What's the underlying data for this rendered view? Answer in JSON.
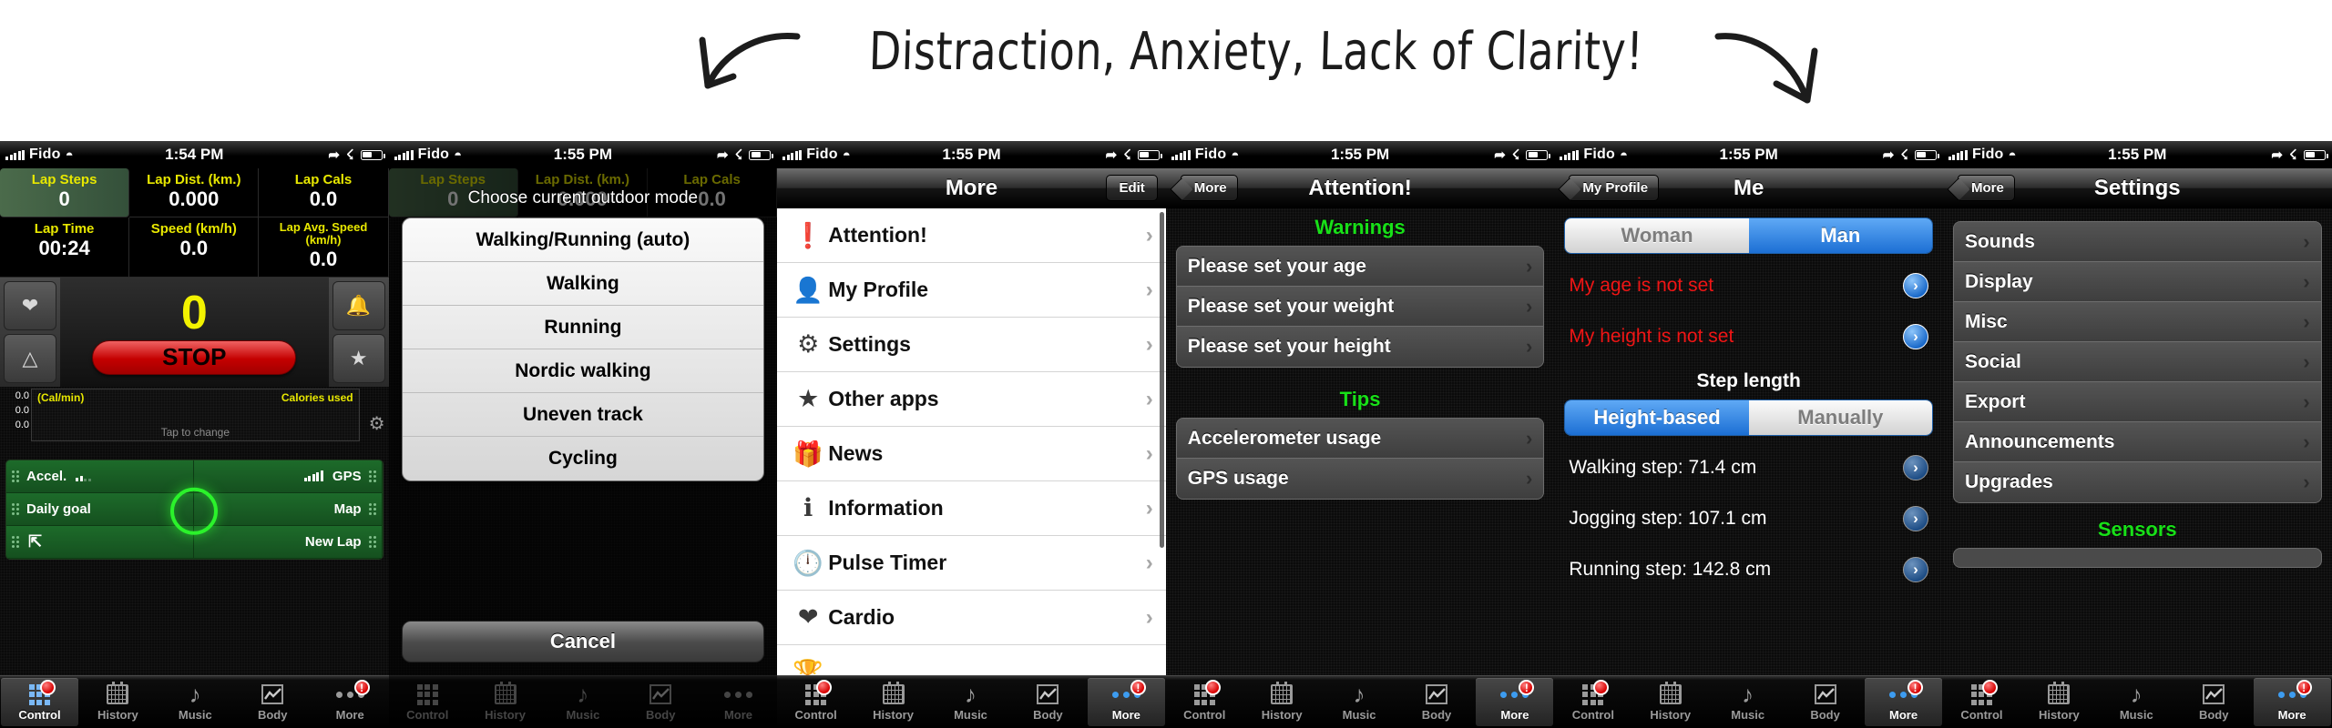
{
  "annotation": {
    "text": "Distraction, Anxiety, Lack of Clarity!"
  },
  "tabbar": {
    "items": [
      {
        "label": "Control",
        "icon": "grid-icon",
        "badge": ""
      },
      {
        "label": "History",
        "icon": "calendar-icon",
        "badge": ""
      },
      {
        "label": "Music",
        "icon": "music-note-icon",
        "badge": ""
      },
      {
        "label": "Body",
        "icon": "chart-icon",
        "badge": ""
      },
      {
        "label": "More",
        "icon": "dots-icon",
        "badge": "!"
      }
    ]
  },
  "panel1": {
    "statusbar": {
      "carrier": "Fido",
      "time": "1:54 PM"
    },
    "lap_cells": [
      {
        "key": "Lap Steps",
        "value": "0",
        "highlight": true
      },
      {
        "key": "Lap Dist. (km.)",
        "value": "0.000",
        "highlight": false
      },
      {
        "key": "Lap Cals",
        "value": "0.0",
        "highlight": false
      },
      {
        "key": "Lap Time",
        "value": "00:24",
        "highlight": false
      },
      {
        "key": "Speed (km/h)",
        "value": "0.0",
        "highlight": false
      },
      {
        "key": "Lap Avg. Speed (km/h)",
        "value": "0.0",
        "highlight": false
      }
    ],
    "step_counter": "0",
    "stop_label": "STOP",
    "side_left": [
      "heart-icon",
      "metronome-icon"
    ],
    "side_right": [
      "bell-icon",
      "bell-star-icon"
    ],
    "cal_axis": [
      "0.0",
      "0.0",
      "0.0"
    ],
    "cal_unit": "(Cal/min)",
    "cal_used": "Calories used",
    "tap_to_change": "Tap to change",
    "green_cells": [
      {
        "label": "Accel.",
        "align": "left",
        "signal": "weak"
      },
      {
        "label": "GPS",
        "align": "right",
        "signal": "full"
      },
      {
        "label": "Daily goal",
        "align": "left",
        "signal": ""
      },
      {
        "label": "Map",
        "align": "right",
        "signal": ""
      },
      {
        "label": "",
        "align": "left",
        "signal": "",
        "icon": "share-icon"
      },
      {
        "label": "New Lap",
        "align": "right",
        "signal": ""
      }
    ]
  },
  "panel2": {
    "statusbar": {
      "carrier": "Fido",
      "time": "1:55 PM"
    },
    "sheet_title": "Choose current outdoor mode",
    "options": [
      "Walking/Running (auto)",
      "Walking",
      "Running",
      "Nordic walking",
      "Uneven track",
      "Cycling"
    ],
    "cancel_label": "Cancel",
    "bg_lap_cells": [
      {
        "key": "Lap Steps",
        "value": "0"
      },
      {
        "key": "Lap Dist. (km.)",
        "value": "0.000"
      },
      {
        "key": "Lap Cals",
        "value": "0.0"
      }
    ]
  },
  "panel3": {
    "statusbar": {
      "carrier": "Fido",
      "time": "1:55 PM"
    },
    "nav": {
      "title": "More",
      "right_button": "Edit"
    },
    "rows": [
      {
        "label": "Attention!",
        "icon": "exclamation-circle-icon"
      },
      {
        "label": "My Profile",
        "icon": "person-icon"
      },
      {
        "label": "Settings",
        "icon": "gear-icon"
      },
      {
        "label": "Other apps",
        "icon": "star-icon"
      },
      {
        "label": "News",
        "icon": "gift-icon"
      },
      {
        "label": "Information",
        "icon": "info-circle-icon"
      },
      {
        "label": "Pulse Timer",
        "icon": "clock-icon"
      },
      {
        "label": "Cardio",
        "icon": "heart-icon"
      }
    ]
  },
  "panel4": {
    "statusbar": {
      "carrier": "Fido",
      "time": "1:55 PM"
    },
    "nav": {
      "title": "Attention!",
      "back_button": "More"
    },
    "groups": [
      {
        "header": "Warnings",
        "color": "#18e018",
        "rows": [
          "Please set your age",
          "Please set your weight",
          "Please set your height"
        ]
      },
      {
        "header": "Tips",
        "color": "#18e018",
        "rows": [
          "Accelerometer usage",
          "GPS usage"
        ]
      }
    ]
  },
  "panel5": {
    "statusbar": {
      "carrier": "Fido",
      "time": "1:55 PM"
    },
    "nav": {
      "title": "Me",
      "back_button": "My Profile"
    },
    "gender_segment": {
      "options": [
        "Woman",
        "Man"
      ],
      "selected": "Man"
    },
    "warnings": [
      {
        "text": "My age is not set",
        "state": "error"
      },
      {
        "text": "My height is not set",
        "state": "error"
      }
    ],
    "step_length_header": "Step length",
    "step_segment": {
      "options": [
        "Height-based",
        "Manually"
      ],
      "selected": "Height-based"
    },
    "steps": [
      "Walking step: 71.4 cm",
      "Jogging step: 107.1 cm",
      "Running step: 142.8 cm"
    ]
  },
  "panel6": {
    "statusbar": {
      "carrier": "Fido",
      "time": "1:55 PM"
    },
    "nav": {
      "title": "Settings",
      "back_button": "More"
    },
    "rows": [
      "Sounds",
      "Display",
      "Misc",
      "Social",
      "Export",
      "Announcements",
      "Upgrades"
    ],
    "sensors_header": "Sensors"
  },
  "colors": {
    "accent_blue": "#1c6fd4",
    "warning_red": "#f01515",
    "group_green": "#18e018",
    "lap_yellow": "#e8e800",
    "stop_red": "#c40000"
  }
}
